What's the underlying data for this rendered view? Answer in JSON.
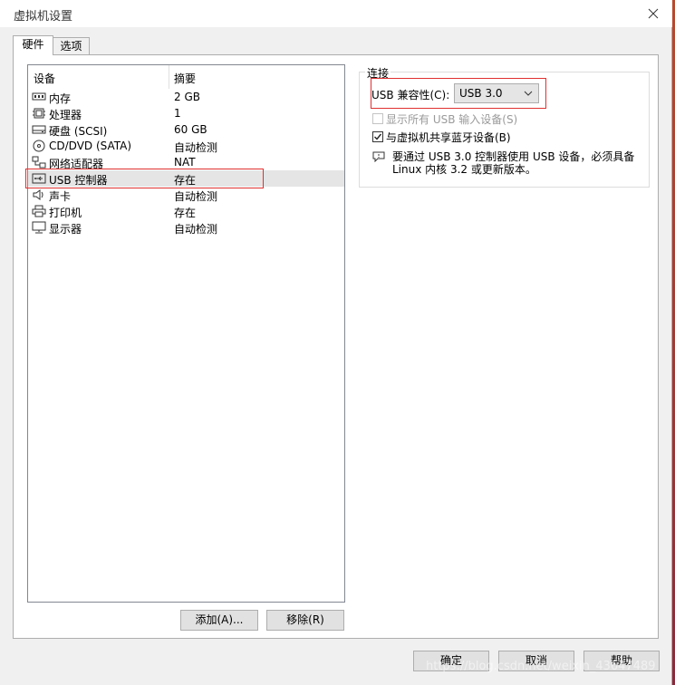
{
  "window": {
    "title": "虚拟机设置"
  },
  "tabs": [
    {
      "label": "硬件",
      "active": true
    },
    {
      "label": "选项",
      "active": false
    }
  ],
  "device_list": {
    "headers": {
      "device": "设备",
      "summary": "摘要"
    },
    "rows": [
      {
        "icon": "memory-icon",
        "name": "内存",
        "summary": "2 GB"
      },
      {
        "icon": "processor-icon",
        "name": "处理器",
        "summary": "1"
      },
      {
        "icon": "hard-disk-icon",
        "name": "硬盘 (SCSI)",
        "summary": "60 GB"
      },
      {
        "icon": "cd-dvd-icon",
        "name": "CD/DVD (SATA)",
        "summary": "自动检测"
      },
      {
        "icon": "network-adapter-icon",
        "name": "网络适配器",
        "summary": "NAT"
      },
      {
        "icon": "usb-controller-icon",
        "name": "USB 控制器",
        "summary": "存在",
        "selected": true
      },
      {
        "icon": "sound-card-icon",
        "name": "声卡",
        "summary": "自动检测"
      },
      {
        "icon": "printer-icon",
        "name": "打印机",
        "summary": "存在"
      },
      {
        "icon": "display-icon",
        "name": "显示器",
        "summary": "自动检测"
      }
    ]
  },
  "buttons": {
    "add": "添加(A)...",
    "remove": "移除(R)",
    "ok": "确定",
    "cancel": "取消",
    "help": "帮助"
  },
  "connection": {
    "group_title": "连接",
    "usb_compat_label": "USB 兼容性(C):",
    "usb_compat_value": "USB 3.0",
    "show_all_usb_label": "显示所有 USB 输入设备(S)",
    "show_all_usb_checked": false,
    "show_all_usb_enabled": false,
    "share_bluetooth_label": "与虚拟机共享蓝牙设备(B)",
    "share_bluetooth_checked": true,
    "info_text": "要通过 USB 3.0 控制器使用 USB 设备，必须具备 Linux 内核 3.2 或更新版本。"
  },
  "watermark": "https://blog.csdn.net/weixin_43647489",
  "colors": {
    "highlight_red": "#e03030",
    "selected_row": "#e5e5e5",
    "desktop": "#b0452a"
  }
}
